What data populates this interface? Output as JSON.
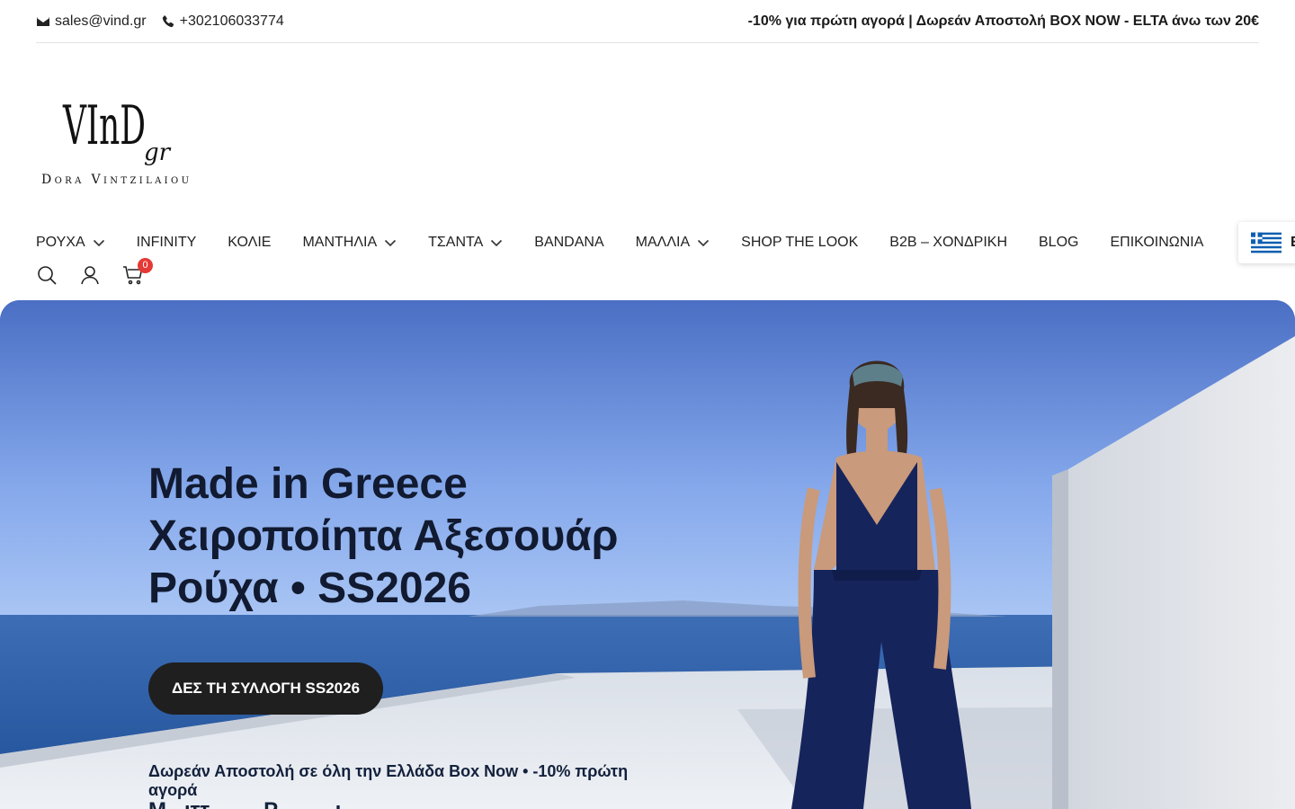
{
  "topbar": {
    "email": "sales@vind.gr",
    "phone": "+302106033774",
    "promo": "-10% για πρώτη αγορά | Δωρεάν Αποστολή BOX NOW - ELTA άνω των 20€"
  },
  "logo": {
    "brand": "VInD",
    "suffix": "gr",
    "tagline": "Dora Vintzilaiou"
  },
  "nav": {
    "items": [
      {
        "label": "ΡΟΥΧΑ",
        "dropdown": true
      },
      {
        "label": "INFINITY",
        "dropdown": false
      },
      {
        "label": "ΚΟΛΙΕ",
        "dropdown": false
      },
      {
        "label": "ΜΑΝΤΗΛΙΑ",
        "dropdown": true
      },
      {
        "label": "ΤΣΑΝΤΑ",
        "dropdown": true
      },
      {
        "label": "BANDANA",
        "dropdown": false
      },
      {
        "label": "ΜΑΛΛΙΑ",
        "dropdown": true
      },
      {
        "label": "SHOP THE LOOK",
        "dropdown": false
      },
      {
        "label": "B2B – ΧΟΝΔΡΙΚΗ",
        "dropdown": false
      },
      {
        "label": "BLOG",
        "dropdown": false
      },
      {
        "label": "ΕΠΙΚΟΙΝΩΝΙΑ",
        "dropdown": false
      }
    ]
  },
  "language": {
    "code": "E",
    "flag": "greek-flag-icon"
  },
  "utilities": {
    "icons": [
      "search-icon",
      "user-icon",
      "cart-icon"
    ],
    "cart_count": "0"
  },
  "hero": {
    "title": "Made in Greece\nΧειροποίητα Αξεσουάρ\nΡούχα • SS2026",
    "cta": "ΔΕΣ ΤΗ ΣΥΛΛΟΓΗ SS2026",
    "note": "Δωρεάν Αποστολή σε όλη την Ελλάδα Box Now • -10% πρώτη αγορά",
    "note_2": "Μ...ιττ.........Ρ..........ι"
  },
  "colors": {
    "cta_bg": "#1f1f1f",
    "badge": "#e53935",
    "sea": "#2d5ea5",
    "sky": "#6b8fdc"
  }
}
